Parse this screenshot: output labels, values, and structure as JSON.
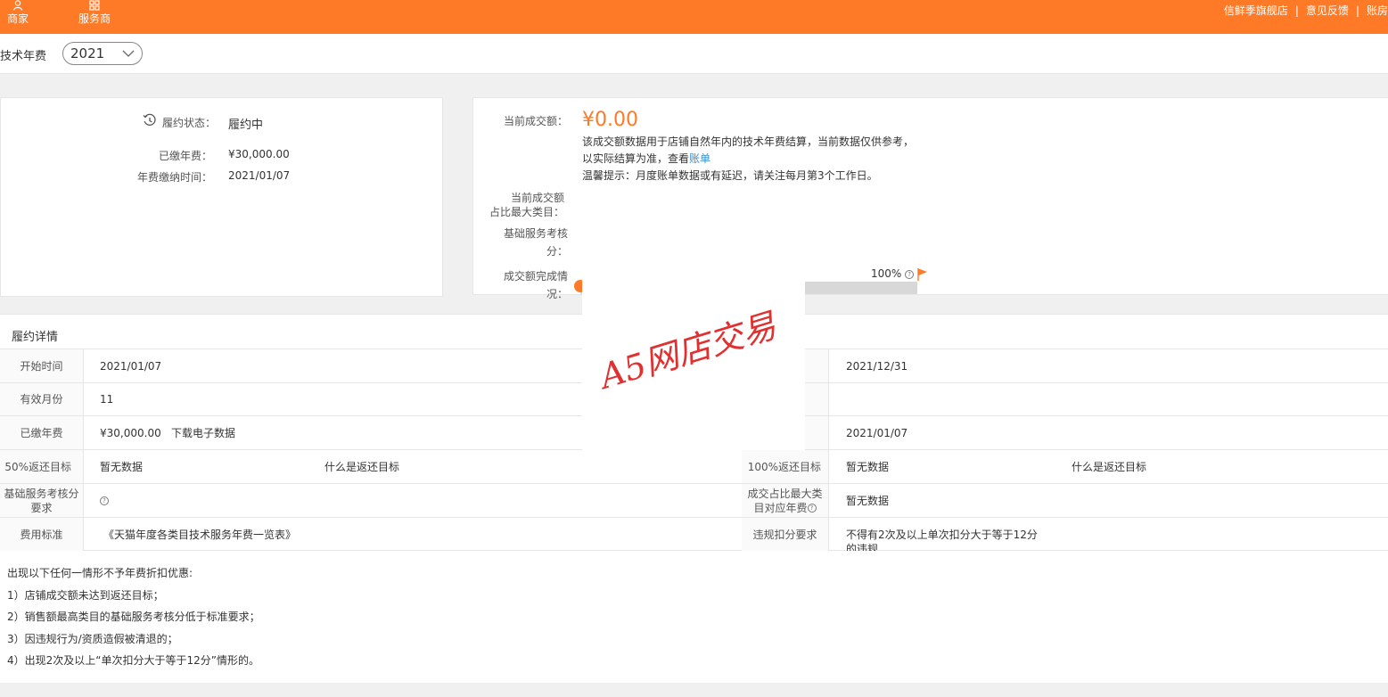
{
  "topbar": {
    "nav": [
      {
        "label": "商家",
        "icon": "user-icon"
      },
      {
        "label": "服务商",
        "icon": "grid-icon"
      }
    ],
    "links": [
      "信鲜季旗舰店",
      "意见反馈",
      "账房"
    ],
    "color": "#ff7a26"
  },
  "year_row": {
    "title": "技术年费",
    "year": "2021"
  },
  "left_card": {
    "status_label": "履约状态：",
    "status_value": "履约中",
    "paid_label": "已缴年费：",
    "paid_value": "¥30,000.00",
    "paytime_label": "年费缴纳时间：",
    "paytime_value": "2021/01/07"
  },
  "right_card": {
    "current_label": "当前成交额：",
    "current_value": "¥0.00",
    "note1": "该成交额数据用于店铺自然年内的技术年费结算，当前数据仅供参考，",
    "note2_prefix": "以实际结算为准，查看",
    "note2_link": "账单",
    "note3": "温馨提示：月度账单数据或有延迟，请关注每月第3个工作日。",
    "max_cat_label_1": "当前成交额",
    "max_cat_label_2": "占比最大类目：",
    "base_score_label_1": "基础服务考核",
    "base_score_label_2": "分：",
    "completion_label_1": "成交额完成情",
    "completion_label_2": "况：",
    "progress_end_label": "100%",
    "progress_fraction": 0.0
  },
  "details": {
    "title": "履约详情",
    "rows": [
      {
        "l_label": "开始时间",
        "l_value": "2021/01/07",
        "r_label": "",
        "r_value": "2021/12/31"
      },
      {
        "l_label": "有效月份",
        "l_value": "11"
      },
      {
        "l_label": "已缴年费",
        "l_value": "¥30,000.00",
        "l_link": "下载电子数据",
        "r_label": "",
        "r_value": "2021/01/07"
      },
      {
        "l_label": "50%返还目标",
        "l_value": "暂无数据",
        "l_link": "什么是返还目标",
        "r_label": "100%返还目标",
        "r_value": "暂无数据",
        "r_link": "什么是返还目标"
      },
      {
        "l_label_1": "基础服务考核分",
        "l_label_2": "要求",
        "r_label_1": "成交占比最大类",
        "r_label_2": "目对应年费",
        "r_value": "暂无数据"
      },
      {
        "l_label": "费用标准",
        "l_link": "《天猫年度各类目技术服务年费一览表》",
        "r_label": "违规扣分要求",
        "r_value_1": "不得有2次及以上单次扣分大于等于12分",
        "r_value_2": "的违规"
      }
    ]
  },
  "rules": [
    "出现以下任何一情形不予年费折扣优惠:",
    "1）店铺成交额未达到返还目标；",
    "2）销售额最高类目的基础服务考核分低于标准要求；",
    "3）因违规行为/资质造假被清退的；",
    "4）出现2次及以上“单次扣分大于等于12分”情形的。"
  ],
  "watermark": "A5网店交易"
}
